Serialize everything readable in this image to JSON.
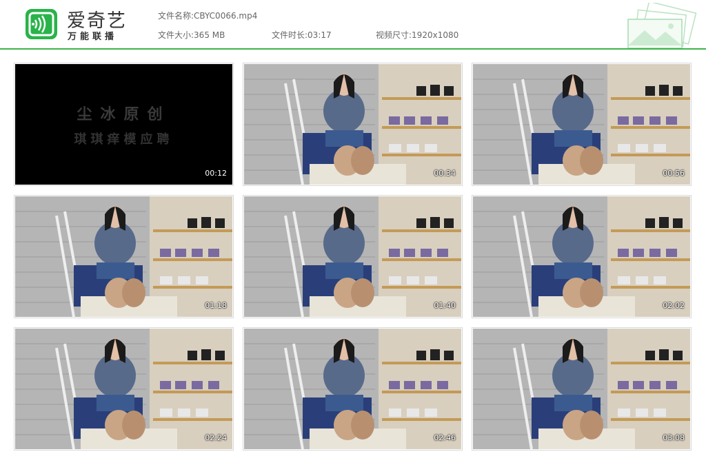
{
  "brand": {
    "name": "爱奇艺",
    "slogan": "万能联播"
  },
  "file": {
    "name_label": "文件名称:",
    "name_value": "CBYC0066.mp4",
    "size_label": "文件大小:",
    "size_value": "365 MB",
    "duration_label": "文件时长:",
    "duration_value": "03:17",
    "resolution_label": "视频尺寸:",
    "resolution_value": "1920x1080"
  },
  "title_card": {
    "line1": "尘冰原创",
    "line2": "琪琪痒模应聘"
  },
  "thumbnails": [
    {
      "timestamp": "00:12"
    },
    {
      "timestamp": "00:34"
    },
    {
      "timestamp": "00:56"
    },
    {
      "timestamp": "01:18"
    },
    {
      "timestamp": "01:40"
    },
    {
      "timestamp": "02:02"
    },
    {
      "timestamp": "02:24"
    },
    {
      "timestamp": "02:46"
    },
    {
      "timestamp": "03:08"
    }
  ],
  "colors": {
    "accent": "#3cb34a",
    "logo_bg": "#29b34a"
  }
}
